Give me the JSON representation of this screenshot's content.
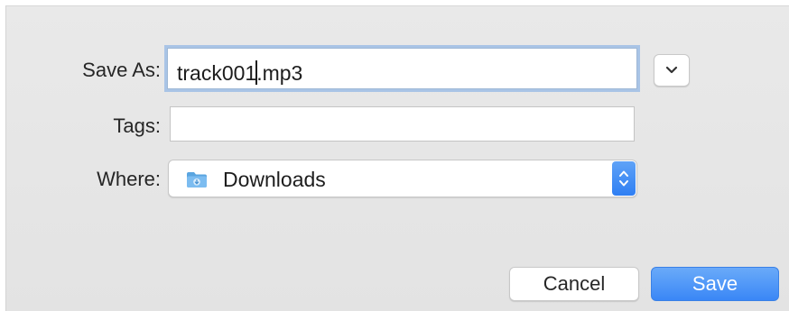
{
  "dialog": {
    "save_as": {
      "label": "Save As:",
      "value_before_caret": "track001",
      "value_after_caret": ".mp3"
    },
    "tags": {
      "label": "Tags:",
      "value": ""
    },
    "where": {
      "label": "Where:",
      "selected": "Downloads",
      "icon": "downloads-folder-icon"
    },
    "expand_icon": "chevron-down-icon",
    "buttons": {
      "cancel": "Cancel",
      "save": "Save"
    }
  },
  "colors": {
    "accent": "#3a87f6",
    "focus_ring": "#a9c4e6",
    "sheet_background": "#e6e6e6"
  }
}
